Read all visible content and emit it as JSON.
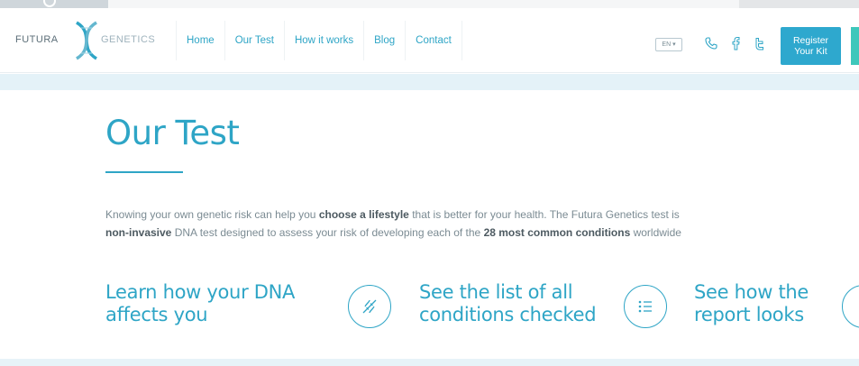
{
  "header": {
    "logo": {
      "left": "FUTURA",
      "right": "GENETICS"
    },
    "nav": [
      "Home",
      "Our Test",
      "How it works",
      "Blog",
      "Contact"
    ],
    "language": "EN ▾",
    "register_button": {
      "line1": "Register",
      "line2": "Your Kit"
    },
    "icons": [
      "phone-icon",
      "facebook-icon",
      "twitter-icon"
    ]
  },
  "main": {
    "title": "Our Test",
    "intro": {
      "s1": "Knowing your own genetic risk can help you ",
      "b1": "choose a lifestyle",
      "s2": " that is better for your health. The Futura Genetics test is",
      "b2": "non-invasive",
      "s3": " DNA test designed to assess your risk of developing each of the ",
      "b3": "28 most common conditions",
      "s4": " worldwide"
    },
    "features": [
      {
        "line1": "Learn how your DNA",
        "line2": "affects you"
      },
      {
        "line1": "See the list of all",
        "line2": "conditions checked",
        "icon": "dna-icon"
      },
      {
        "line1": "See how the",
        "line2": "report looks",
        "icon": "list-icon"
      }
    ]
  },
  "colors": {
    "accent": "#2ea5c6",
    "button": "#2ea8ce",
    "band": "#e4f2f8",
    "text": "#7b8b93"
  }
}
